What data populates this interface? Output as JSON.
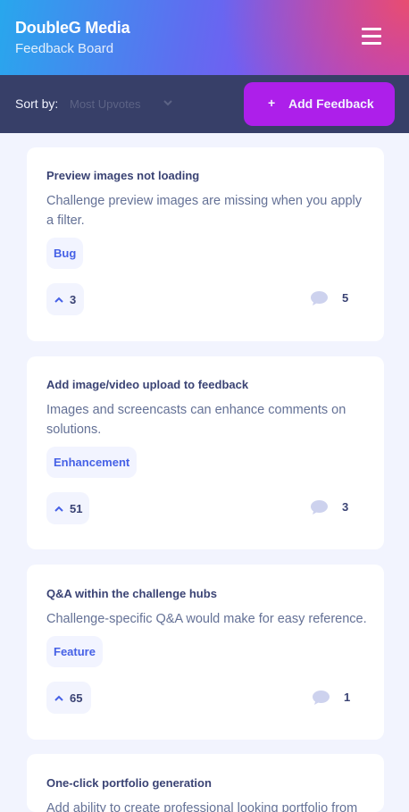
{
  "header": {
    "title": "DoubleG Media",
    "subtitle": "Feedback Board"
  },
  "toolbar": {
    "sort_label": "Sort by:",
    "sort_value": "Most Upvotes",
    "add_button_plus": "+",
    "add_button_label": "Add Feedback"
  },
  "feedback": [
    {
      "title": "Preview images not loading",
      "description": "Challenge preview images are missing when you apply a filter.",
      "category": "Bug",
      "upvotes": "3",
      "comments": "5"
    },
    {
      "title": "Add image/video upload to feedback",
      "description": "Images and screencasts can enhance comments on solutions.",
      "category": "Enhancement",
      "upvotes": "51",
      "comments": "3"
    },
    {
      "title": "Q&A within the challenge hubs",
      "description": "Challenge-specific Q&A would make for easy reference.",
      "category": "Feature",
      "upvotes": "65",
      "comments": "1"
    },
    {
      "title": "One-click portfolio generation",
      "description": "Add ability to create professional looking portfolio from"
    }
  ],
  "colors": {
    "accent_purple": "#ad1fea",
    "accent_blue": "#4661e6",
    "toolbar_bg": "#373f68",
    "page_bg": "#f2f4fe"
  }
}
